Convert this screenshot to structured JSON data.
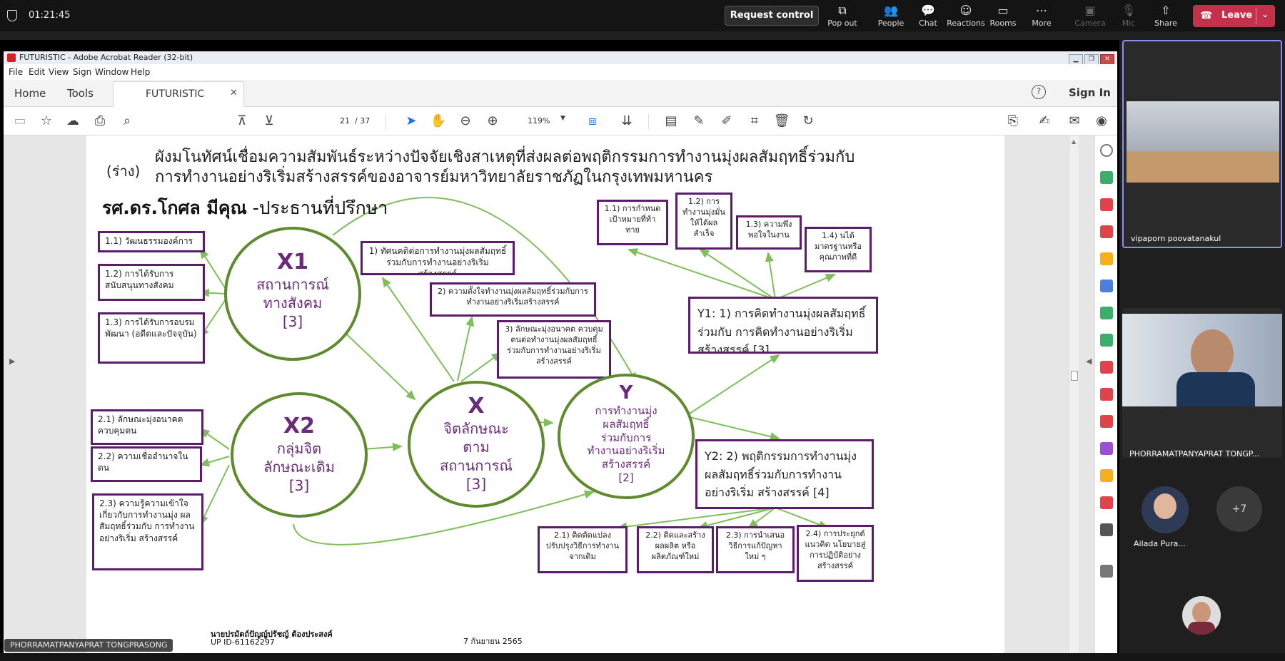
{
  "teams": {
    "timer": "01:21:45",
    "request_control": "Request control",
    "toolbar": [
      {
        "label": "Pop out",
        "icon": "pop-out-icon",
        "glyph": "⧉"
      },
      {
        "label": "People",
        "icon": "people-icon",
        "glyph": "👥"
      },
      {
        "label": "Chat",
        "icon": "chat-icon",
        "glyph": "💬"
      },
      {
        "label": "Reactions",
        "icon": "reactions-icon",
        "glyph": "☺"
      },
      {
        "label": "Rooms",
        "icon": "rooms-icon",
        "glyph": "▭"
      },
      {
        "label": "More",
        "icon": "more-icon",
        "glyph": "⋯"
      },
      {
        "label": "Camera",
        "icon": "camera-off-icon",
        "glyph": "▣"
      },
      {
        "label": "Mic",
        "icon": "mic-off-icon",
        "glyph": "🎙"
      },
      {
        "label": "Share",
        "icon": "share-icon",
        "glyph": "⇧"
      }
    ],
    "leave": "Leave",
    "presenter": "PHORRAMATPANYAPRAT TONGPRASONG",
    "participants": [
      {
        "name": "vipaporn poovatanakul"
      },
      {
        "name": "PHORRAMATPANYAPRAT TONGP..."
      },
      {
        "name": "Ailada Pura..."
      }
    ],
    "more_count": "+7"
  },
  "acrobat": {
    "window_title": "FUTURISTIC - Adobe Acrobat Reader (32-bit)",
    "menu": [
      "File",
      "Edit",
      "View",
      "Sign",
      "Window",
      "Help"
    ],
    "tabs": {
      "home": "Home",
      "tools": "Tools",
      "doc": "FUTURISTIC"
    },
    "sign_in": "Sign In",
    "page_current": "21",
    "page_total": "/ 37",
    "zoom": "119%"
  },
  "slide": {
    "draft": "(ร่าง)",
    "title_line1": "ผังมโนทัศน์เชื่อมความสัมพันธ์ระหว่างปัจจัยเชิงสาเหตุที่ส่งผลต่อพฤติกรรมการทำงานมุ่งผลสัมฤทธิ์ร่วมกับ",
    "title_line2": "การทำงานอย่างริเริ่มสร้างสรรค์ของอาจารย์มหาวิทยาลัยราชภัฏในกรุงเทพมหานคร",
    "advisor_name": "รศ.ดร.โกศล มีคุณ",
    "advisor_role": " -ประธานที่ปรึกษา",
    "x1": {
      "code": "X1",
      "line1": "สถานการณ์",
      "line2": "ทางสังคม",
      "count": "[3]"
    },
    "x2": {
      "code": "X2",
      "line1": "กลุ่มจิต",
      "line2": "ลักษณะเดิม",
      "count": "[3]"
    },
    "x": {
      "code": "X",
      "line1": "จิตลักษณะ",
      "line2": "ตาม",
      "line3": "สถานการณ์",
      "count": "[3]"
    },
    "y": {
      "code": "Y",
      "line1": "การทำงานมุ่ง",
      "line2": "ผลสัมฤทธิ์",
      "line3": "ร่วมกับการ",
      "line4": "ทำงานอย่างริเริ่ม",
      "line5": "สร้างสรรค์",
      "count": "[2]"
    },
    "x1_items": [
      "1.1) วัฒนธรรมองค์การ",
      "1.2) การได้รับการ สนับสนุนทางสังคม",
      "1.3) การได้รับการอบรม พัฒนา (อดีตและปัจจุบัน)"
    ],
    "x2_items": [
      "2.1) ลักษณะมุ่งอนาคต ควบคุมตน",
      "2.2) ความเชื่ออำนาจใน ตน",
      "2.3) ความรู้ความเข้าใจ เกี่ยวกับการทำงานมุ่ง ผลสัมฤทธิ์ร่วมกับ การทำงานอย่างริเริ่ม สร้างสรรค์"
    ],
    "x_items": [
      "1) ทัศนคติต่อการทำงานมุ่งผลสัมฤทธิ์ ร่วมกับการทำงานอย่างริเริ่มสร้างสรรค์",
      "2) ความตั้งใจทำงานมุ่งผลสัมฤทธิ์ร่วมกับการ ทำงานอย่างริเริ่มสร้างสรรค์",
      "3) ลักษณะมุ่งอนาคต ควบคุม ตนต่อทำงานมุ่งผลสัมฤทธิ์ ร่วมกับการทำงานอย่างริเริ่ม สร้างสรรค์"
    ],
    "y1": "Y1: 1) การคิดทำงานมุ่งผลสัมฤทธิ์ร่วมกับ การคิดทำงานอย่างริเริ่มสร้างสรรค์ [3]",
    "y1_items": [
      "1.1) การกำหนด เป้าหมายที่ท้า ทาย",
      "1.2) การ ทำงานมุ่งมั่น ให้ได้ผล สำเร็จ",
      "1.3) ความพึง พอใจในงาน",
      "1.4) นได้ มาตรฐานหรือ คุณภาพที่ดี"
    ],
    "y2": "Y2: 2) พฤติกรรมการทำงานมุ่ง ผลสัมฤทธิ์ร่วมกับการทำงานอย่างริเริ่ม สร้างสรรค์ [4]",
    "y2_items": [
      "2.1) ติดตัดแปลง ปรับปรุงวิธีการทำงาน จากเดิม",
      "2.2) ติดและสร้าง ผลผลิต หรือ ผลิตภัณฑ์ใหม่",
      "2.3) การนำเสนอ วิธีการแก้ปัญหา ใหม่ ๆ",
      "2.4) การประยุกต์ แนวคิด นโยบายสู่ การปฏิบัติอย่าง สร้างสรรค์"
    ],
    "footer_name": "นายปรมัตถ์ปัญญ์ปรัชญ์ ต้องประสงค์",
    "footer_id": "UP ID-61162297",
    "footer_date": "7 กันยายน 2565"
  },
  "colors": {
    "box_border": "#5b1d6a",
    "circle_border": "#5f8b2e",
    "circle_text": "#6b2b7b",
    "arrow": "#7fbf5a",
    "leave": "#c4314b"
  }
}
